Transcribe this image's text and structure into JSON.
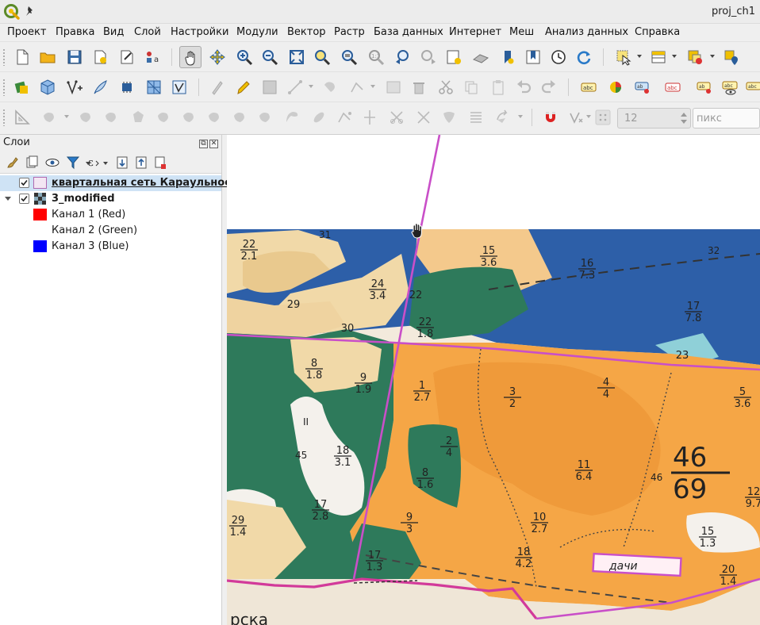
{
  "window": {
    "title": "proj_ch1"
  },
  "menu": [
    "Проект",
    "Правка",
    "Вид",
    "Слой",
    "Настройки",
    "Модули",
    "Вектор",
    "Растр",
    "База данных",
    "Интернет",
    "Меш",
    "Анализ данных",
    "Справка"
  ],
  "toolbar_symbology": {
    "size_value": "12",
    "unit_value": "пикс"
  },
  "layers_panel": {
    "title": "Слои",
    "layers": [
      {
        "name": "квартальная сеть Караульное",
        "checked": true,
        "selected": true,
        "type": "polygon"
      },
      {
        "name": "3_modified",
        "checked": true,
        "expanded": true,
        "type": "raster"
      }
    ],
    "bands": [
      {
        "label": "Канал 1 (Red)",
        "color": "#ff0000"
      },
      {
        "label": "Канал 2 (Green)",
        "color": ""
      },
      {
        "label": "Канал 3 (Blue)",
        "color": "#0000ff"
      }
    ]
  },
  "map": {
    "cursor": "pan-hand-icon",
    "boundary_color": "#cc44cc",
    "labels": {
      "block_top_left": "31",
      "block_top_right": "32",
      "block_center": "46",
      "block_left": "45",
      "big_num": "46",
      "big_den": "69",
      "dachi": "дачи",
      "bottom_text": "рска",
      "island": "II"
    },
    "compartments": [
      {
        "num": "22",
        "den": "2.1"
      },
      {
        "num": "15",
        "den": "3.6"
      },
      {
        "num": "16",
        "den": "7.3"
      },
      {
        "num": "22",
        "den": ""
      },
      {
        "num": "24",
        "den": "3.4"
      },
      {
        "num": "29",
        "den": ""
      },
      {
        "num": "30",
        "den": ""
      },
      {
        "num": "22",
        "den": "1.8"
      },
      {
        "num": "17",
        "den": "7.8"
      },
      {
        "num": "23",
        "den": ""
      },
      {
        "num": "8",
        "den": "1.8"
      },
      {
        "num": "9",
        "den": "1.9"
      },
      {
        "num": "1",
        "den": "2.7"
      },
      {
        "num": "3",
        "den": "2"
      },
      {
        "num": "4",
        "den": "4"
      },
      {
        "num": "5",
        "den": "3.6"
      },
      {
        "num": "2",
        "den": "4"
      },
      {
        "num": "8",
        "den": "1.6"
      },
      {
        "num": "11",
        "den": "6.4"
      },
      {
        "num": "18",
        "den": "3.1"
      },
      {
        "num": "17",
        "den": "2.8"
      },
      {
        "num": "10",
        "den": "2.7"
      },
      {
        "num": "9",
        "den": "3"
      },
      {
        "num": "29",
        "den": "1.4"
      },
      {
        "num": "15",
        "den": "1.3"
      },
      {
        "num": "17",
        "den": "1.3"
      },
      {
        "num": "18",
        "den": "4.2"
      },
      {
        "num": "20",
        "den": "1.4"
      },
      {
        "num": "12",
        "den": "9.7"
      }
    ]
  }
}
